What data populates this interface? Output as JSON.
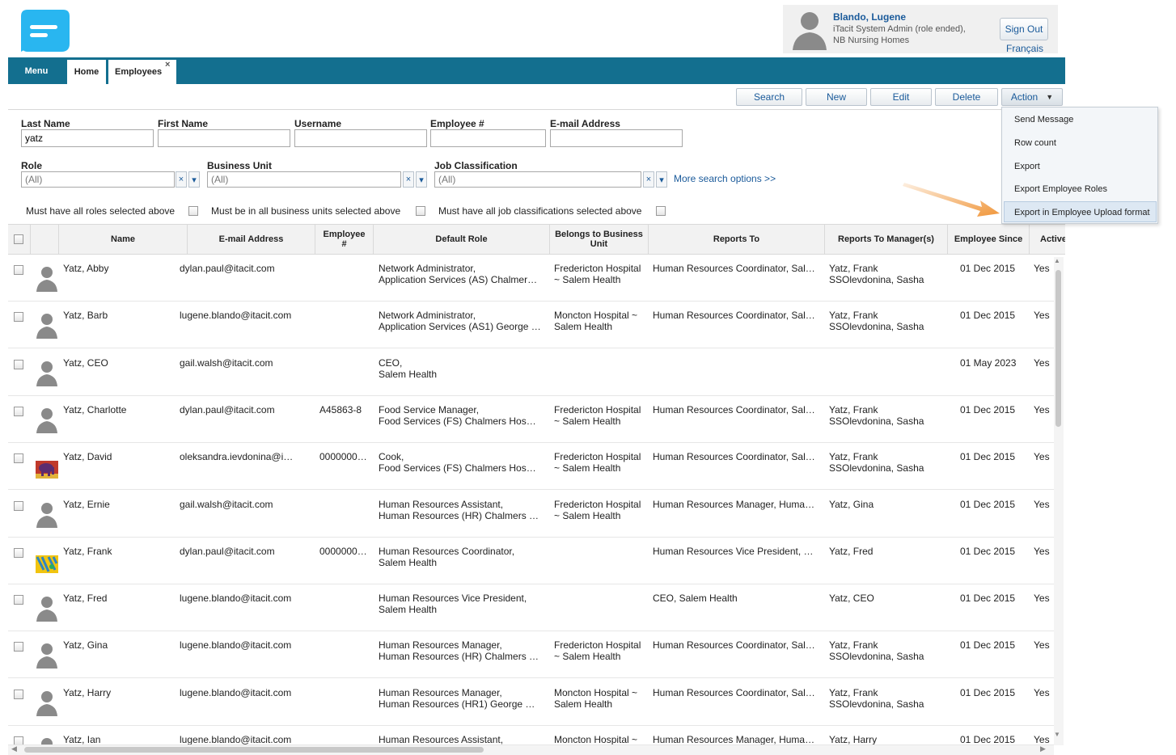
{
  "colors": {
    "accent": "#136f8f",
    "link": "#1a5a9a",
    "arrow": "#f0963a"
  },
  "user": {
    "name": "Blando, Lugene",
    "role": "iTacit System Admin (role ended),",
    "org": "NB Nursing Homes"
  },
  "header": {
    "sign_out": "Sign Out",
    "language": "Français"
  },
  "nav": {
    "menu": "Menu",
    "tabs": [
      {
        "label": "Home"
      },
      {
        "label": "Employees"
      }
    ],
    "close_glyph": "×"
  },
  "toolbar": {
    "search": "Search",
    "new": "New",
    "edit": "Edit",
    "delete": "Delete",
    "action": "Action"
  },
  "action_menu": {
    "items": [
      "Send Message",
      "Row count",
      "Export",
      "Export Employee Roles",
      "Export in Employee Upload format"
    ],
    "highlighted": "Export in Employee Upload format"
  },
  "search": {
    "last_name": {
      "label": "Last Name",
      "value": "yatz"
    },
    "first_name": {
      "label": "First Name",
      "value": ""
    },
    "username": {
      "label": "Username",
      "value": ""
    },
    "employee_no": {
      "label": "Employee #",
      "value": ""
    },
    "email": {
      "label": "E-mail Address",
      "value": ""
    },
    "role": {
      "label": "Role",
      "value": "(All)"
    },
    "business_unit": {
      "label": "Business Unit",
      "value": "(All)"
    },
    "job_classification": {
      "label": "Job Classification",
      "value": "(All)"
    },
    "more_options": "More search options >>",
    "clear_glyph": "×",
    "drop_glyph": "▾",
    "checks": {
      "roles": "Must have all roles selected above",
      "units": "Must be in all business units selected above",
      "jobs": "Must have all job classifications selected above"
    }
  },
  "table": {
    "columns": {
      "name": "Name",
      "email": "E-mail Address",
      "emp_no_1": "Employee",
      "emp_no_2": "#",
      "default_role": "Default Role",
      "bu_1": "Belongs to Business",
      "bu_2": "Unit",
      "reports_to": "Reports To",
      "reports_mgr": "Reports To Manager(s)",
      "since": "Employee Since",
      "active": "Active"
    },
    "rows": [
      {
        "name": "Yatz, Abby",
        "email": "dylan.paul@itacit.com",
        "emp": "",
        "role1": "Network Administrator,",
        "role2": "Application Services (AS) Chalmer…",
        "bu1": "Fredericton Hospital",
        "bu2": "~ Salem Health",
        "reports": "Human Resources Coordinator, Sal…",
        "mgr1": "Yatz, Frank",
        "mgr2": "SSOlevdonina, Sasha",
        "since": "01 Dec 2015",
        "active": "Yes",
        "photo": "silhouette"
      },
      {
        "name": "Yatz, Barb",
        "email": "lugene.blando@itacit.com",
        "emp": "",
        "role1": "Network Administrator,",
        "role2": "Application Services (AS1) George …",
        "bu1": "Moncton Hospital ~",
        "bu2": "Salem Health",
        "reports": "Human Resources Coordinator, Sal…",
        "mgr1": "Yatz, Frank",
        "mgr2": "SSOlevdonina, Sasha",
        "since": "01 Dec 2015",
        "active": "Yes",
        "photo": "silhouette"
      },
      {
        "name": "Yatz, CEO",
        "email": "gail.walsh@itacit.com",
        "emp": "",
        "role1": "CEO,",
        "role2": "Salem Health",
        "bu1": "",
        "bu2": "",
        "reports": "",
        "mgr1": "",
        "mgr2": "",
        "since": "01 May 2023",
        "active": "Yes",
        "photo": "silhouette"
      },
      {
        "name": "Yatz, Charlotte",
        "email": "dylan.paul@itacit.com",
        "emp": "A45863-8",
        "role1": "Food Service Manager,",
        "role2": "Food Services (FS) Chalmers Hos…",
        "bu1": "Fredericton Hospital",
        "bu2": "~ Salem Health",
        "reports": "Human Resources Coordinator, Sal…",
        "mgr1": "Yatz, Frank",
        "mgr2": "SSOlevdonina, Sasha",
        "since": "01 Dec 2015",
        "active": "Yes",
        "photo": "silhouette"
      },
      {
        "name": "Yatz, David",
        "email": "oleksandra.ievdonina@i…",
        "emp": "0000000…",
        "role1": "Cook,",
        "role2": "Food Services (FS) Chalmers Hos…",
        "bu1": "Fredericton Hospital",
        "bu2": "~ Salem Health",
        "reports": "Human Resources Coordinator, Sal…",
        "mgr1": "Yatz, Frank",
        "mgr2": "SSOlevdonina, Sasha",
        "since": "01 Dec 2015",
        "active": "Yes",
        "photo": "elephant"
      },
      {
        "name": "Yatz, Ernie",
        "email": "gail.walsh@itacit.com",
        "emp": "",
        "role1": "Human Resources Assistant,",
        "role2": "Human Resources (HR) Chalmers …",
        "bu1": "Fredericton Hospital",
        "bu2": "~ Salem Health",
        "reports": "Human Resources Manager, Huma…",
        "mgr1": "Yatz, Gina",
        "mgr2": "",
        "since": "01 Dec 2015",
        "active": "Yes",
        "photo": "silhouette"
      },
      {
        "name": "Yatz, Frank",
        "email": "dylan.paul@itacit.com",
        "emp": "0000000…",
        "role1": "Human Resources Coordinator,",
        "role2": "Salem Health",
        "bu1": "",
        "bu2": "",
        "reports": "Human Resources Vice President, …",
        "mgr1": "Yatz, Fred",
        "mgr2": "",
        "since": "01 Dec 2015",
        "active": "Yes",
        "photo": "pattern"
      },
      {
        "name": "Yatz, Fred",
        "email": "lugene.blando@itacit.com",
        "emp": "",
        "role1": "Human Resources Vice President,",
        "role2": "Salem Health",
        "bu1": "",
        "bu2": "",
        "reports": "CEO, Salem Health",
        "mgr1": "Yatz, CEO",
        "mgr2": "",
        "since": "01 Dec 2015",
        "active": "Yes",
        "photo": "silhouette"
      },
      {
        "name": "Yatz, Gina",
        "email": "lugene.blando@itacit.com",
        "emp": "",
        "role1": "Human Resources Manager,",
        "role2": "Human Resources (HR) Chalmers …",
        "bu1": "Fredericton Hospital",
        "bu2": "~ Salem Health",
        "reports": "Human Resources Coordinator, Sal…",
        "mgr1": "Yatz, Frank",
        "mgr2": "SSOlevdonina, Sasha",
        "since": "01 Dec 2015",
        "active": "Yes",
        "photo": "silhouette"
      },
      {
        "name": "Yatz, Harry",
        "email": "lugene.blando@itacit.com",
        "emp": "",
        "role1": "Human Resources Manager,",
        "role2": "Human Resources (HR1) George …",
        "bu1": "Moncton Hospital ~",
        "bu2": "Salem Health",
        "reports": "Human Resources Coordinator, Sal…",
        "mgr1": "Yatz, Frank",
        "mgr2": "SSOlevdonina, Sasha",
        "since": "01 Dec 2015",
        "active": "Yes",
        "photo": "silhouette"
      },
      {
        "name": "Yatz, Ian",
        "email": "lugene.blando@itacit.com",
        "emp": "",
        "role1": "Human Resources Assistant,",
        "role2": "",
        "bu1": "Moncton Hospital ~",
        "bu2": "",
        "reports": "Human Resources Manager, Huma…",
        "mgr1": "Yatz, Harry",
        "mgr2": "",
        "since": "01 Dec 2015",
        "active": "Yes",
        "photo": "silhouette"
      }
    ]
  }
}
